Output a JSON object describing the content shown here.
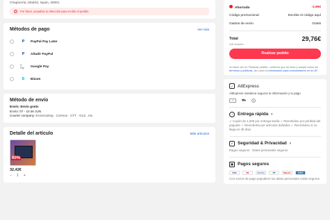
{
  "address": {
    "line": "Chapinería, Madrid, Spain, 28001",
    "warning": "Por favor, actualiza tu dirección para recibir el pedido"
  },
  "payment": {
    "title": "Métodos de pago",
    "more": "Ver más",
    "items": [
      {
        "label": "PayPal Pay Later",
        "logo": "P"
      },
      {
        "label": "Añadir PayPal",
        "logo": "P"
      },
      {
        "label": "Google Pay",
        "logo": "G Pay"
      },
      {
        "label": "Bizum",
        "logo": "B"
      }
    ]
  },
  "shipping": {
    "title": "Método de envío",
    "line1": "Envío: Envío gratis",
    "line2": "Envío: 07 - 10 de JUN",
    "line3_prefix": "Courier company:",
    "carriers": "Ecoscooting · Correos · CTT · GLS , etc."
  },
  "items": {
    "title": "Detalle del artículo",
    "more": "Más artículos",
    "discount": "60%",
    "price": "32,42€",
    "qty": "1",
    "minus": "−",
    "plus": "+"
  },
  "summary": {
    "saved_label": "Ahorrado",
    "saved_value": "-2,66€",
    "promo_label": "Código promocional",
    "promo_value": "Escribe el código aquí",
    "ship_label": "Gastos de envío",
    "ship_value": "Gratis",
    "total_label": "Total",
    "total_value": "29,76€",
    "iva": "IVA incluido",
    "button": "Realizar pedido",
    "legal_1": "Al hacer clic en 'Realizar pedido', confirmo que he leído y acepto todos los",
    "legal_link1": "términos y políticas",
    "legal_2": ", así como la",
    "legal_link2": "información para consumidores en la UE."
  },
  "aliexpress": {
    "brand": "AliExpress",
    "desc": "AliExpress mantiene seguros tu información y tu pago"
  },
  "delivery": {
    "title": "Entrega rápida",
    "arrow": "›",
    "text": "✓ Cupón de 1,00€ por entrega tardía ✓ Reembolso por pérdida del paquete ✓ Reembolso por artículos dañados ✓ Reembolso si no llega en 35 días"
  },
  "security": {
    "title": "Seguridad & Privacidad",
    "arrow": "›",
    "text": "Pagos seguros · Datos personales seguros"
  },
  "secure_pay": {
    "title": "Pagos seguros",
    "logos": [
      "VISA",
      "MC",
      "SafePay",
      "PP",
      "Maestro",
      "AMEX"
    ],
    "text": "Con socios de pago populares tus datos personales están seguros"
  }
}
